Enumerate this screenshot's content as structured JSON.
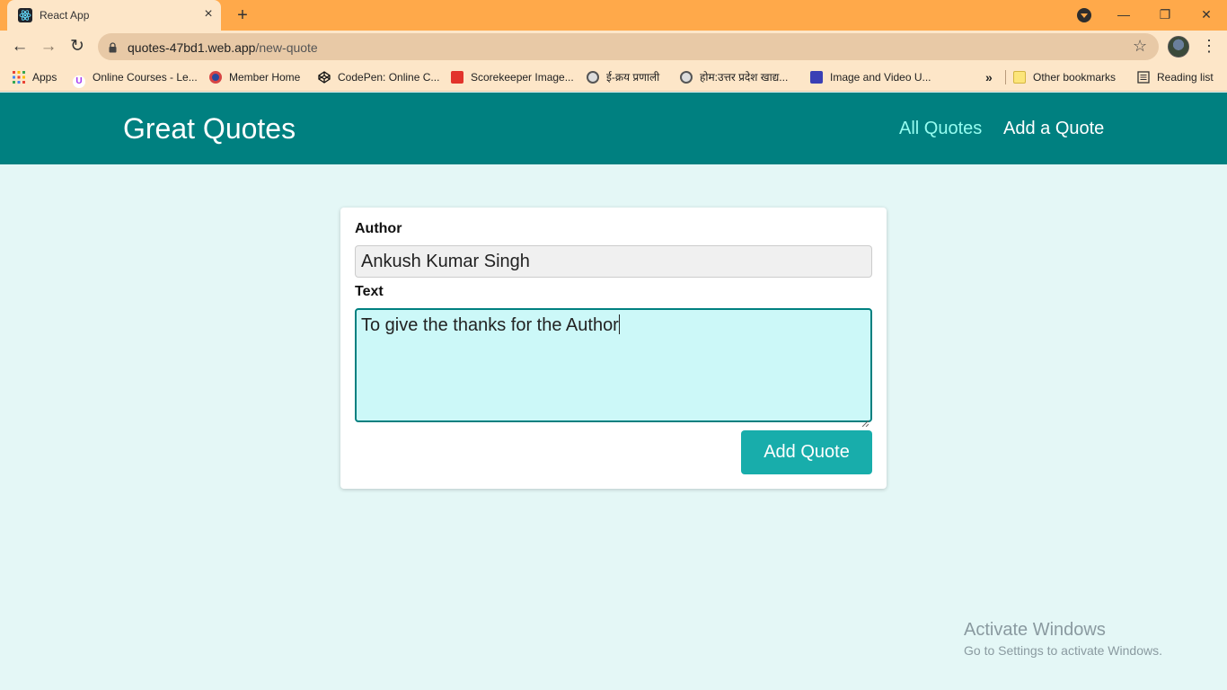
{
  "browser": {
    "tab_title": "React App",
    "url_domain": "quotes-47bd1.web.app",
    "url_path": "/new-quote",
    "bookmarks": [
      {
        "label": "Apps",
        "icon": "apps-grid-icon"
      },
      {
        "label": "Online Courses - Le...",
        "icon": "udemy-icon"
      },
      {
        "label": "Member Home",
        "icon": "member-home-icon"
      },
      {
        "label": "CodePen: Online C...",
        "icon": "codepen-icon"
      },
      {
        "label": "Scorekeeper Image...",
        "icon": "scorekeeper-icon"
      },
      {
        "label": "ई-क्रय प्रणाली",
        "icon": "up-gov-icon"
      },
      {
        "label": "होम:उत्तर प्रदेश खाद्य...",
        "icon": "up-gov-icon"
      },
      {
        "label": "Image and Video U...",
        "icon": "image-upload-icon"
      }
    ],
    "other_bookmarks": "Other bookmarks",
    "reading_list": "Reading list"
  },
  "app": {
    "logo": "Great Quotes",
    "nav": [
      {
        "label": "All Quotes",
        "active": true
      },
      {
        "label": "Add a Quote",
        "active": false
      }
    ],
    "form": {
      "author_label": "Author",
      "author_value": "Ankush Kumar Singh",
      "text_label": "Text",
      "text_value": "To give the thanks for the Author",
      "submit_label": "Add Quote"
    }
  },
  "watermark": {
    "title": "Activate Windows",
    "subtitle": "Go to Settings to activate Windows."
  },
  "colors": {
    "tabstrip": "#ffa94a",
    "header": "#008080",
    "active_nav": "#95fcf0",
    "button": "#18adab",
    "page_bg": "#e4f7f6"
  }
}
